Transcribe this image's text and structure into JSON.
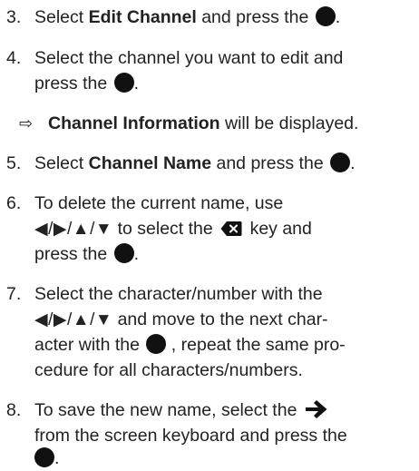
{
  "steps": [
    {
      "number": "3.",
      "line1": {
        "pre": "Select ",
        "bold": "Edit Channel",
        "post": " and press the ",
        "end": "."
      }
    },
    {
      "number": "4.",
      "line1": "Select the channel you want to edit and",
      "line2": {
        "pre": "press the ",
        "end": "."
      }
    },
    {
      "result": true,
      "symbol": "⇨",
      "bold": "Channel Information",
      "post": " will be displayed."
    },
    {
      "number": "5.",
      "line1": {
        "pre": "Select ",
        "bold": "Channel Name",
        "post": " and press the ",
        "end": "."
      }
    },
    {
      "number": "6.",
      "line1": "To delete the current name, use",
      "line2": {
        "nav": "◀/▶/▲/▼",
        "pre": " to select the ",
        "post": " key and"
      },
      "line3": {
        "pre": "press the ",
        "end": "."
      }
    },
    {
      "number": "7.",
      "line1": "Select the character/number with the",
      "line2": {
        "nav": "◀/▶/▲/▼",
        "post": " and move to the next char-"
      },
      "line3": {
        "pre": "acter with the ",
        "post": " , repeat the same pro-"
      },
      "line4": "cedure for all characters/numbers."
    },
    {
      "number": "8.",
      "line1": {
        "pre": "To save the new name, select the "
      },
      "line2": "from the screen keyboard and press the",
      "line3": {
        "end": "."
      }
    }
  ],
  "icons": {
    "ok_button": "ok-button-icon",
    "delete_key": "delete-key-icon",
    "right_arrow": "right-arrow-icon",
    "result_arrow": "result-arrow-icon"
  }
}
